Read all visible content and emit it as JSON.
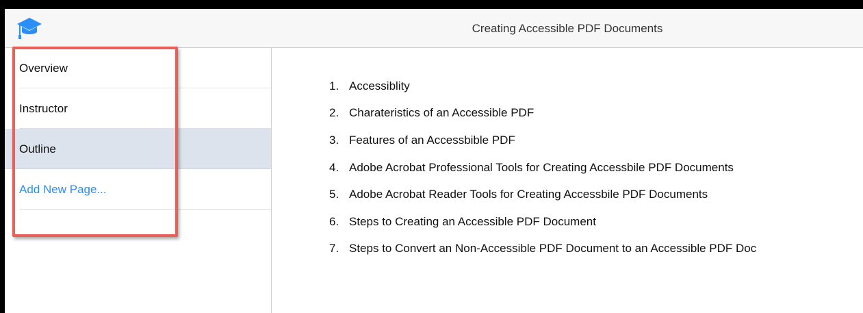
{
  "header": {
    "title": "Creating Accessible PDF Documents",
    "icon": "graduation-cap-icon",
    "icon_color": "#2a8ff7"
  },
  "sidebar": {
    "items": [
      {
        "label": "Overview",
        "selected": false
      },
      {
        "label": "Instructor",
        "selected": false
      },
      {
        "label": "Outline",
        "selected": true
      },
      {
        "label": "Add New Page...",
        "selected": false
      }
    ],
    "selected_bg": "#dde3ec",
    "link_color": "#2a8ff7"
  },
  "annotation": {
    "box_color": "#e8605a"
  },
  "outline": {
    "items": [
      {
        "num": "1.",
        "text": "Accessiblity"
      },
      {
        "num": "2.",
        "text": "Charateristics of an Accessible PDF"
      },
      {
        "num": "3.",
        "text": "Features of an Accessbible PDF"
      },
      {
        "num": "4.",
        "text": "Adobe Acrobat Professional Tools for Creating Accessbile PDF Documents"
      },
      {
        "num": "5.",
        "text": "Adobe Acrobat Reader Tools for Creating Accessbile PDF Documents"
      },
      {
        "num": "6.",
        "text": "Steps to Creating an Accessible PDF Document"
      },
      {
        "num": "7.",
        "text": "Steps to Convert an Non-Accessible PDF Document to an Accessible PDF Doc"
      }
    ]
  }
}
